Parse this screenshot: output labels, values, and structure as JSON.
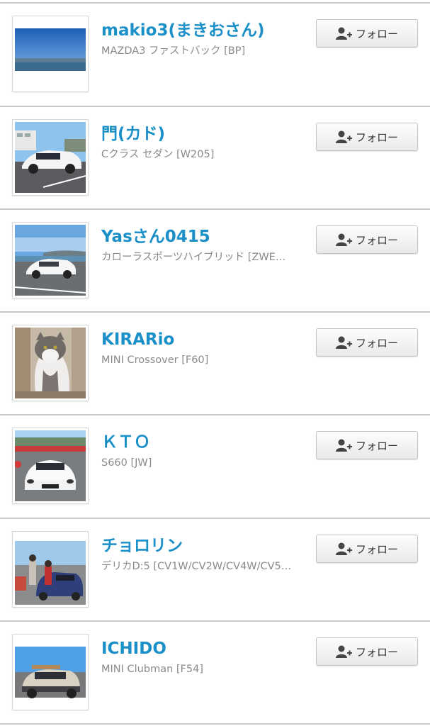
{
  "follow_label": "フォロー",
  "users": [
    {
      "name": "makio3(まきおさん)",
      "car": "MAZDA3 ファストバック [BP]"
    },
    {
      "name": "門(カド)",
      "car": "Cクラス セダン [W205]"
    },
    {
      "name": "Yasさん0415",
      "car": "カローラスポーツハイブリッド [ZWE…"
    },
    {
      "name": "KIRARio",
      "car": "MINI Crossover [F60]"
    },
    {
      "name": "ＫＴＯ",
      "car": "S660 [JW]"
    },
    {
      "name": "チョロリン",
      "car": "デリカD:5 [CV1W/CV2W/CV4W/CV5…"
    },
    {
      "name": "ICHIDO",
      "car": "MINI Clubman [F54]"
    }
  ],
  "colors": {
    "username": "#1a8fc8",
    "subtitle": "#8a8a8a",
    "divider": "#c9c9c9"
  }
}
